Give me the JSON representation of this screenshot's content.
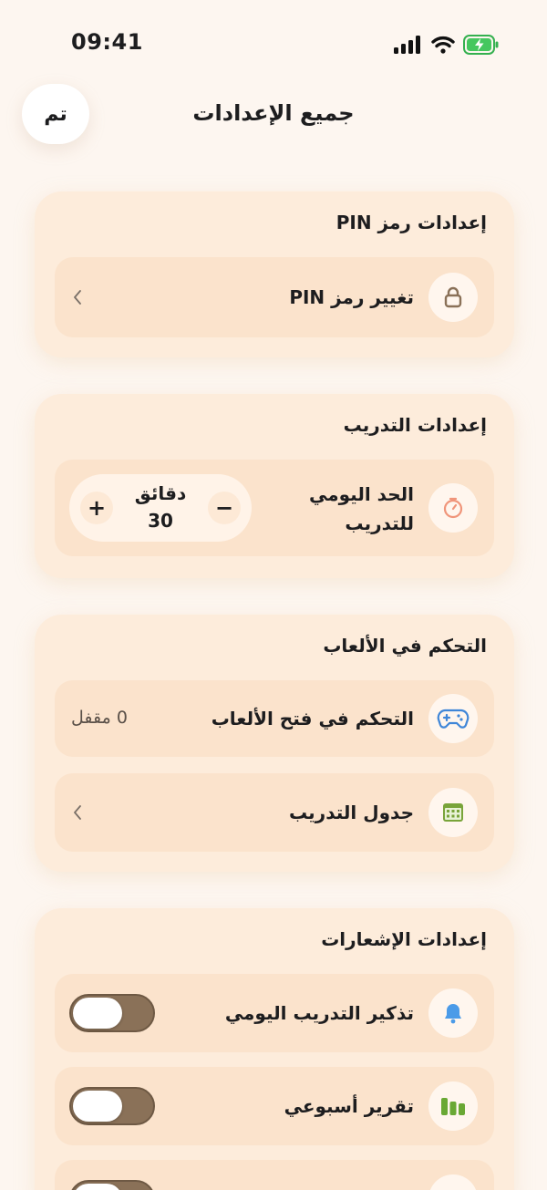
{
  "status": {
    "time": "09:41"
  },
  "header": {
    "title": "جميع الإعدادات",
    "done_label": "تم"
  },
  "pin_section": {
    "title": "إعدادات رمز PIN",
    "change_pin": {
      "label": "تغيير رمز PIN",
      "icon": "lock-icon"
    }
  },
  "training_section": {
    "title": "إعدادات التدريب",
    "daily_limit": {
      "label_line1": "الحد اليومي",
      "label_line2": "للتدريب",
      "icon": "timer-icon",
      "unit": "دقائق",
      "value": "30",
      "minus": "−",
      "plus": "+"
    }
  },
  "games_section": {
    "title": "التحكم في الألعاب",
    "game_control": {
      "label": "التحكم في فتح الألعاب",
      "value": "0 مقفل",
      "icon": "gamepad-icon"
    },
    "schedule": {
      "label": "جدول التدريب",
      "icon": "calendar-icon"
    }
  },
  "notifications_section": {
    "title": "إعدادات الإشعارات",
    "daily_reminder": {
      "label": "تذكير التدريب اليومي",
      "icon": "bell-icon",
      "enabled": false
    },
    "weekly_report": {
      "label": "تقرير أسبوعي",
      "icon": "chart-icon",
      "enabled": false
    },
    "third_item": {
      "icon": "trophy-icon",
      "enabled": false
    }
  },
  "colors": {
    "background": "#fdf6f0",
    "section": "#fdecdb",
    "row": "#fbe3cc",
    "toggle_track": "#8a7158",
    "timer": "#f0957a",
    "gamepad": "#3f86d8",
    "calendar": "#79a43a",
    "bell": "#4b9be8",
    "chart": "#69a834"
  }
}
